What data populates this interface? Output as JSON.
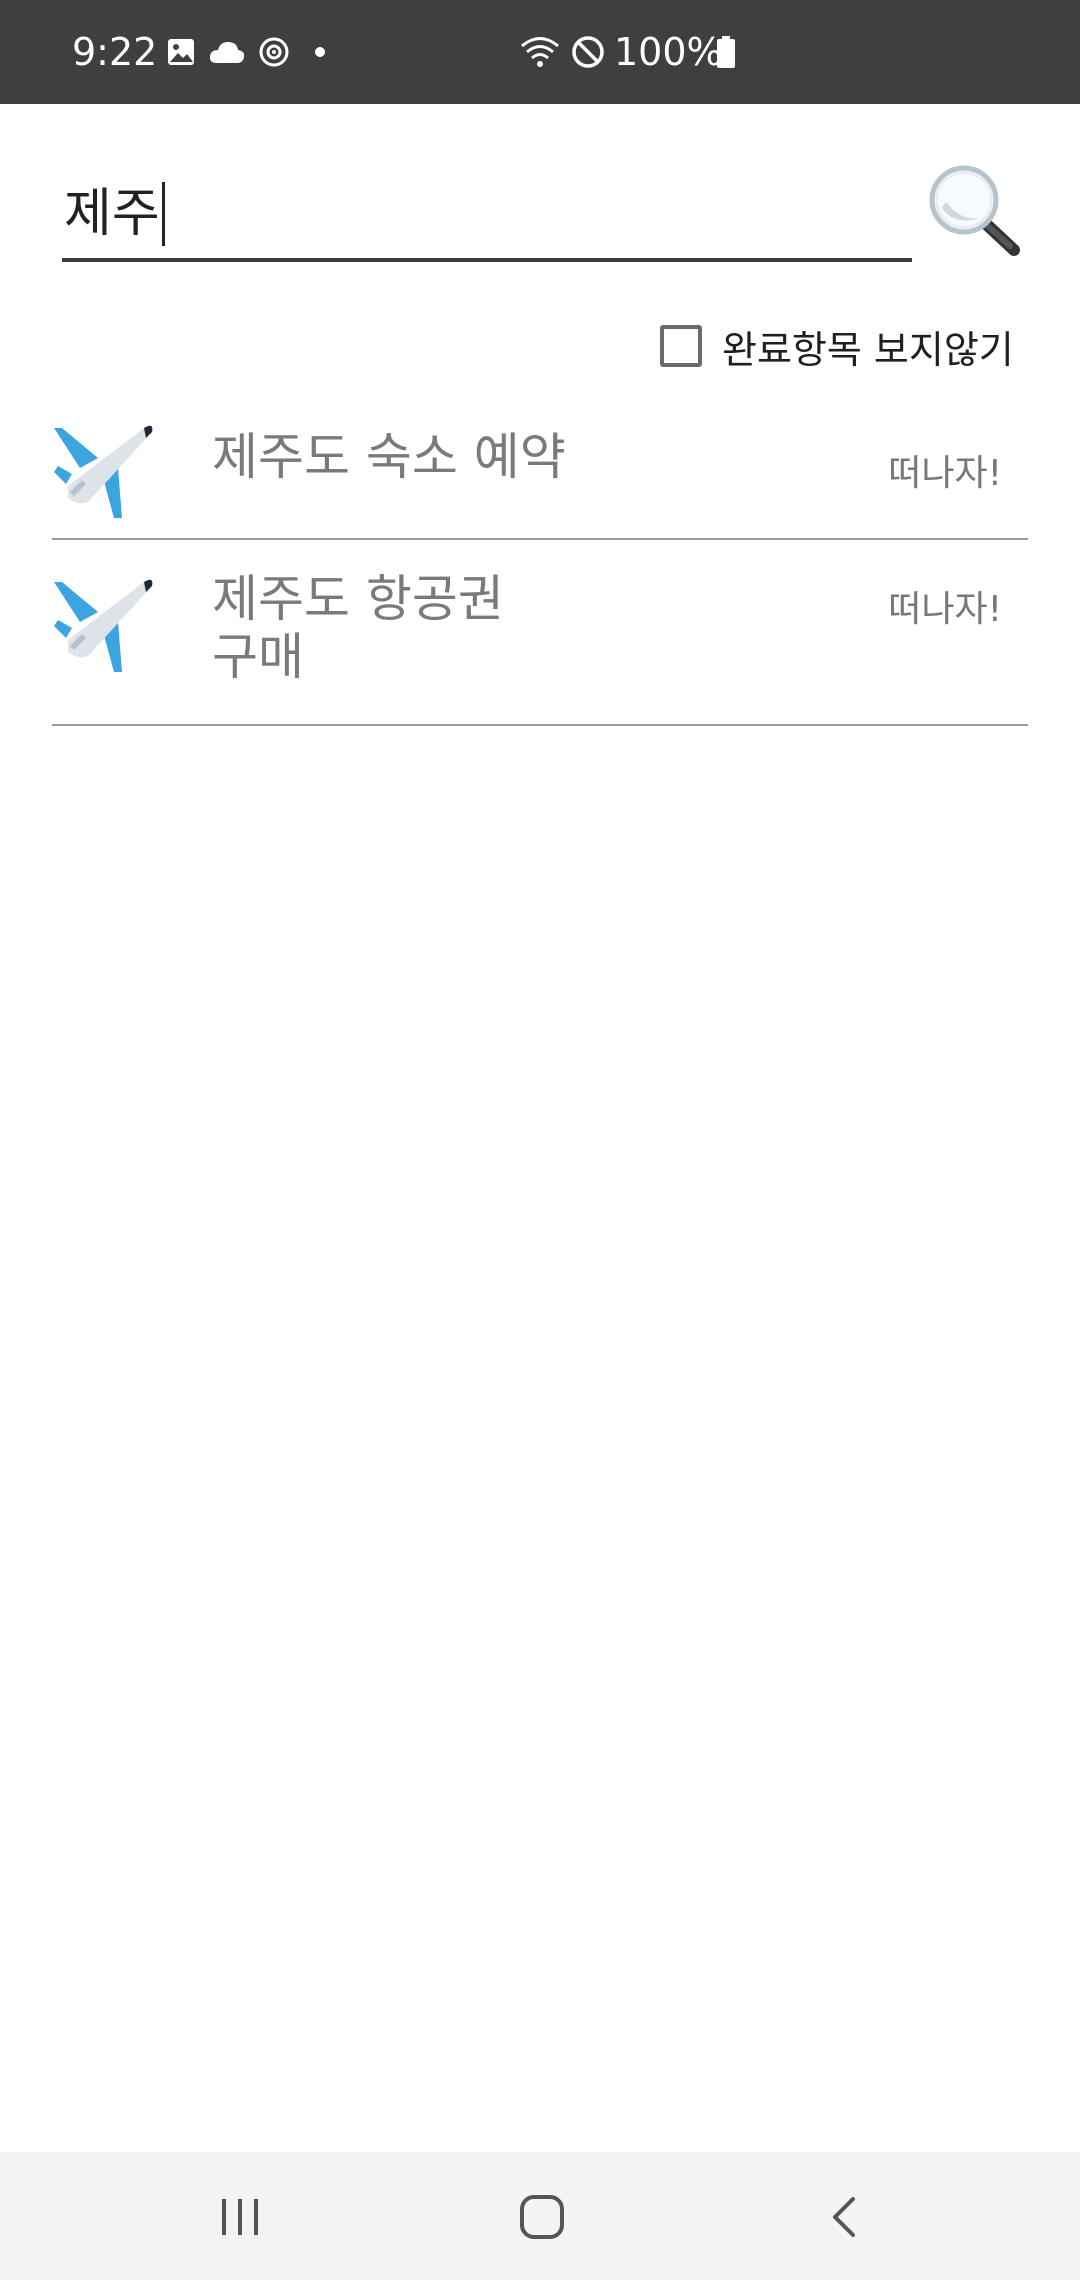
{
  "status_bar": {
    "time": "9:22",
    "battery": "100%",
    "icons": [
      "image-icon",
      "cloud-icon",
      "sync-icon",
      "dot-icon",
      "wifi-icon",
      "do-not-disturb-icon",
      "battery-icon"
    ]
  },
  "search": {
    "value": "제주",
    "button_icon": "magnifier-icon"
  },
  "filter": {
    "hide_completed_label": "완료항목 보지않기",
    "checked": false
  },
  "todo_list": {
    "items": [
      {
        "icon": "airplane-icon",
        "title_lines": [
          "제주도 숙소 예약"
        ],
        "badge": "떠나자!"
      },
      {
        "icon": "airplane-icon",
        "title_lines": [
          "제주도 항공권",
          "구매"
        ],
        "badge": "떠나자!"
      }
    ]
  },
  "colors": {
    "status_bar_bg": "#3f3f3f",
    "nav_bar_bg": "#f4f4f4",
    "item_text": "#7a7a7a",
    "divider": "#9e9e9e",
    "plane_blue": "#3ca4e0"
  },
  "nav_bar": {
    "buttons": [
      "recent-apps-icon",
      "home-icon",
      "back-icon"
    ]
  }
}
